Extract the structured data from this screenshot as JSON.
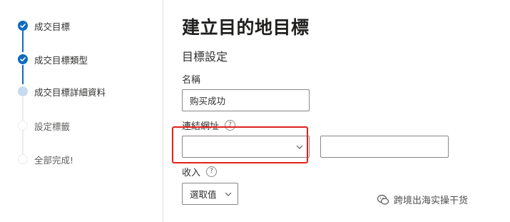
{
  "steps": [
    {
      "label": "成交目標",
      "state": "done"
    },
    {
      "label": "成交目標類型",
      "state": "done"
    },
    {
      "label": "成交目標詳細資料",
      "state": "current"
    },
    {
      "label": "設定標籤",
      "state": "pending"
    },
    {
      "label": "全部完成!",
      "state": "pending"
    }
  ],
  "main": {
    "title": "建立目的地目標",
    "section": "目標設定",
    "name_label": "名稱",
    "name_value": "购买成功",
    "url_label": "連結網址",
    "url_value": "",
    "income_label": "收入",
    "income_select": "選取值",
    "help_glyph": "?"
  },
  "watermark": {
    "text": "跨境出海实操干货"
  },
  "colors": {
    "accent": "#0f6cbd",
    "highlight": "#e0211b"
  }
}
